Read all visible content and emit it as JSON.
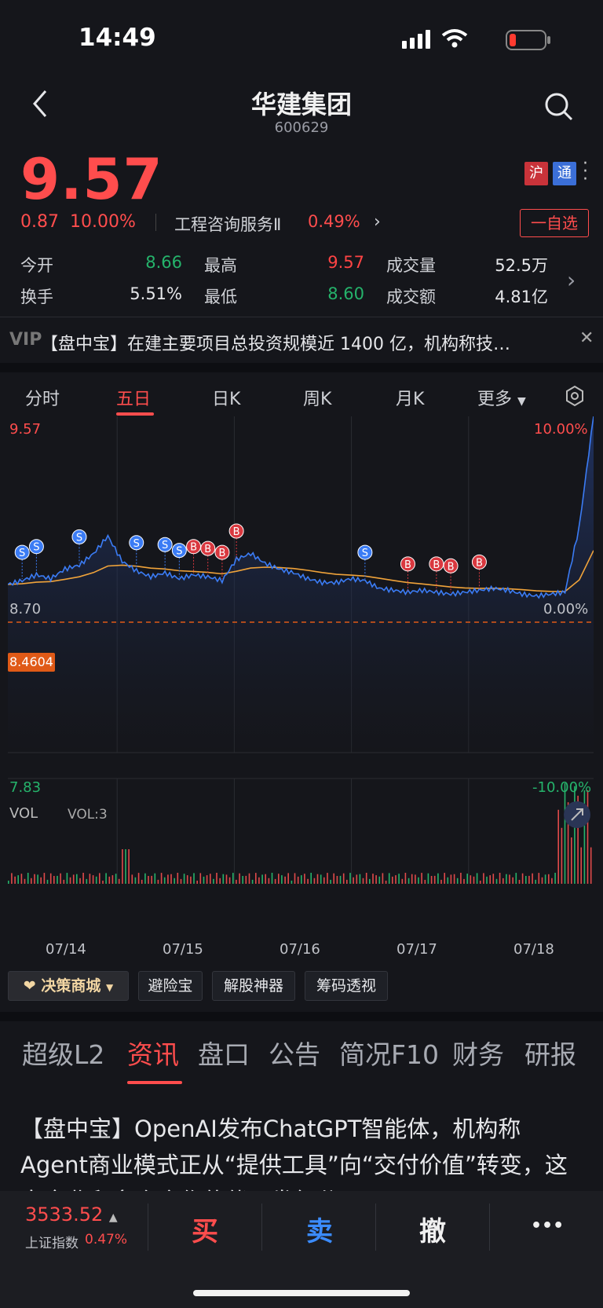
{
  "status_bar": {
    "time": "14:49"
  },
  "header": {
    "title": "华建集团",
    "code": "600629"
  },
  "quote": {
    "price": "9.57",
    "change": "0.87",
    "change_pct": "10.00%",
    "sector": "工程咨询服务Ⅱ",
    "sector_change": "0.49%",
    "tags": [
      "沪",
      "通"
    ],
    "watch_label": "一自选"
  },
  "stats": {
    "open_label": "今开",
    "open": "8.66",
    "high_label": "最高",
    "high": "9.57",
    "volume_label": "成交量",
    "volume": "52.5万",
    "turnover_label": "换手",
    "turnover": "5.51%",
    "low_label": "最低",
    "low": "8.60",
    "amount_label": "成交额",
    "amount": "4.81亿"
  },
  "ticker": {
    "vip": "VIP",
    "text": "【盘中宝】在建主要项目总投资规模近 1400 亿，机构称技…"
  },
  "chart_tabs": [
    "分时",
    "五日",
    "日K",
    "周K",
    "月K",
    "更多"
  ],
  "chart_data": {
    "type": "line",
    "x": [
      "07/14",
      "07/15",
      "07/16",
      "07/17",
      "07/18"
    ],
    "y_max": "9.57",
    "y_mid": "8.70",
    "y_min": "7.83",
    "pct_max": "10.00%",
    "pct_mid": "0.00%",
    "pct_min": "-10.00%",
    "avg_price": "8.4604",
    "volume_label": "VOL",
    "volume_value": "VOL:3",
    "series": [
      {
        "values": [
          8.7,
          8.72,
          8.75,
          8.73,
          8.78,
          8.8,
          8.86,
          8.95,
          8.82,
          8.77,
          8.74,
          8.76,
          8.73,
          8.75,
          8.74,
          8.72,
          8.83,
          8.86,
          8.81,
          8.78,
          8.76,
          8.73,
          8.71,
          8.71,
          8.73,
          8.72,
          8.68,
          8.67,
          8.66,
          8.67,
          8.66,
          8.65,
          8.66,
          8.67,
          8.68,
          8.67,
          8.65,
          8.64,
          8.65,
          8.66,
          9.0,
          9.57
        ]
      }
    ],
    "markers": [
      {
        "label": "S"
      },
      {
        "label": "S"
      },
      {
        "label": "S"
      },
      {
        "label": "S"
      },
      {
        "label": "S"
      },
      {
        "label": "S"
      },
      {
        "label": "S"
      },
      {
        "label": "B"
      },
      {
        "label": "B"
      },
      {
        "label": "B"
      },
      {
        "label": "B"
      },
      {
        "label": "B"
      },
      {
        "label": "B"
      },
      {
        "label": "B"
      },
      {
        "label": "B"
      }
    ]
  },
  "tools": [
    "决策商城",
    "避险宝",
    "解股神器",
    "筹码透视"
  ],
  "bottom_tabs": [
    "超级L2",
    "资讯",
    "盘口",
    "公告",
    "简况F10",
    "财务",
    "研报"
  ],
  "article": {
    "text": "【盘中宝】OpenAI发布ChatGPT智能体，机构称Agent商业模式正从“提供工具”向“交付价值”转变，这家企业和多个合作伙伴研发细分Agent"
  },
  "bottom_bar": {
    "index_value": "3533.52",
    "index_name": "上证指数",
    "index_pct": "0.47%",
    "buy": "买",
    "sell": "卖",
    "cancel": "撤",
    "more": "•••"
  },
  "colors": {
    "up": "#ff4d4d",
    "down": "#25b36b",
    "price_line": "#3b7cf5",
    "avg_line": "#f0a33a"
  }
}
